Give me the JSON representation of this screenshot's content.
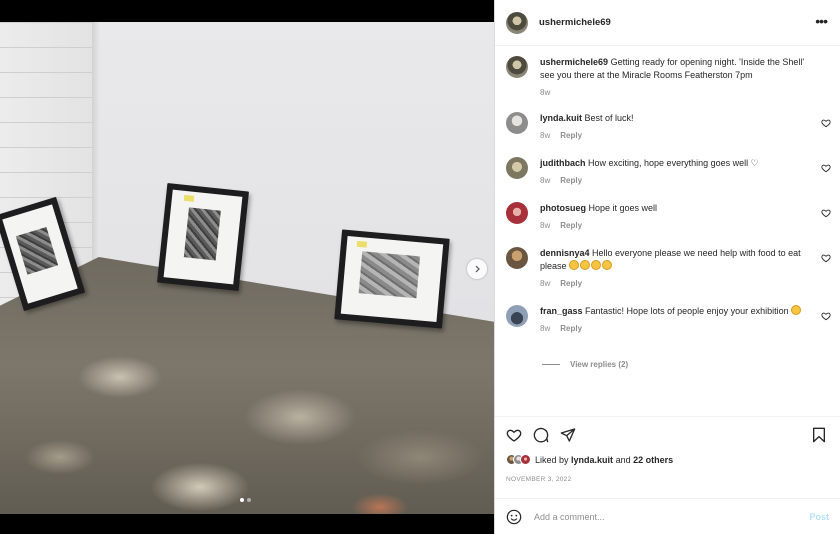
{
  "post": {
    "username": "ushermichele69",
    "caption": "Getting ready for opening night. 'Inside the Shell' see you there at the Miracle Rooms Featherston 7pm",
    "caption_age": "8w",
    "photo_icons": {
      "next": "chevron-right-icon",
      "more": "more-options-icon"
    },
    "carousel": {
      "slides": 2,
      "active": 1
    }
  },
  "comments": [
    {
      "user": "lynda.kuit",
      "text": "Best of luck!",
      "age": "8w",
      "reply_label": "Reply"
    },
    {
      "user": "judithbach",
      "text": "How exciting, hope everything goes well ♡",
      "age": "8w",
      "reply_label": "Reply"
    },
    {
      "user": "photosueg",
      "text": "Hope it goes well",
      "age": "8w",
      "reply_label": "Reply"
    },
    {
      "user": "dennisnya4",
      "text": "Hello everyone please we need help with food to eat please",
      "age": "8w",
      "reply_label": "Reply",
      "emoji_count": 4
    },
    {
      "user": "fran_gass",
      "text": "Fantastic! Hope lots of people enjoy your exhibition",
      "age": "8w",
      "reply_label": "Reply",
      "emoji_count": 1
    }
  ],
  "view_replies": "View replies (2)",
  "likes": {
    "prefix": "Liked by",
    "user": "lynda.kuit",
    "and": "and",
    "others": "22 others"
  },
  "date": "NOVEMBER 3, 2022",
  "add_comment": {
    "placeholder": "Add a comment...",
    "post_label": "Post"
  },
  "icons": [
    "heart-icon",
    "comment-icon",
    "share-icon",
    "bookmark-icon",
    "emoji-icon"
  ],
  "colors": {
    "link": "#b2dffc",
    "muted": "#8e8e8e",
    "text": "#262626"
  }
}
